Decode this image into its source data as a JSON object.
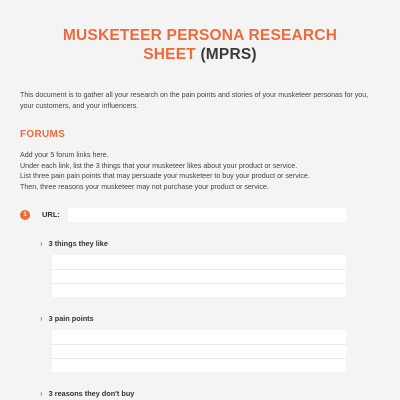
{
  "title": {
    "orange_line1": "MUSKETEER PERSONA RESEARCH",
    "orange_line2": "SHEET",
    "dark_suffix": "(MPRS)"
  },
  "intro": "This document is to gather all your research on the pain points and stories of your musketeer personas for you, your customers, and your influencers.",
  "forums": {
    "heading": "FORUMS",
    "instructions": [
      "Add your 5 forum links here.",
      "Under each link, list the 3 things that your musketeer likes about your product or service.",
      "List three pain pain points that may persuade your musketeer to buy your product or service.",
      "Then, three reasons your musketeer may not purchase your product or service."
    ],
    "entry": {
      "number": "1",
      "url_label": "URL:",
      "url_value": "",
      "likes_label": "3 things they like",
      "pain_label": "3 pain points",
      "reasons_label": "3 reasons they don't buy"
    }
  },
  "colors": {
    "accent": "#ef6a3a",
    "background": "#f4f4f4"
  }
}
